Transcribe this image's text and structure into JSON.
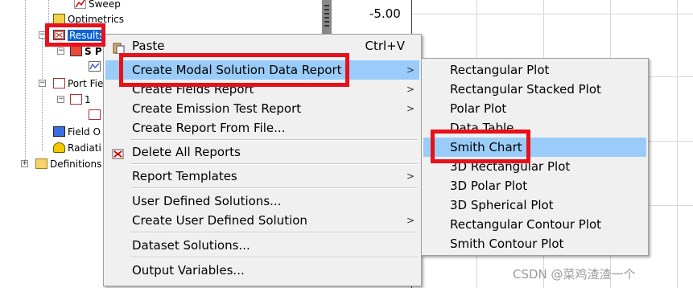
{
  "tree": {
    "sweep": "Sweep",
    "optimetrics": "Optimetrics",
    "results": "Results",
    "s_param": "S P",
    "port_field": "Port Fie",
    "port_1": "1",
    "field_overlays": "Field O",
    "radiation": "Radiati",
    "definitions": "Definitions"
  },
  "plot": {
    "y_tick": "-5.00"
  },
  "main_menu": {
    "items": [
      {
        "label": "Paste",
        "shortcut": "Ctrl+V"
      },
      {
        "label": "Create Modal Solution Data Report"
      },
      {
        "label": "Create Fields Report"
      },
      {
        "label": "Create Emission Test Report"
      },
      {
        "label": "Create Report From File..."
      },
      {
        "label": "Delete All Reports"
      },
      {
        "label": "Report Templates"
      },
      {
        "label": "User Defined Solutions..."
      },
      {
        "label": "Create User Defined Solution"
      },
      {
        "label": "Dataset Solutions..."
      },
      {
        "label": "Output Variables..."
      }
    ]
  },
  "sub_menu": {
    "items": [
      {
        "label": "Rectangular Plot"
      },
      {
        "label": "Rectangular Stacked Plot"
      },
      {
        "label": "Polar Plot"
      },
      {
        "label": "Data Table"
      },
      {
        "label": "Smith Chart"
      },
      {
        "label": "3D Rectangular Plot"
      },
      {
        "label": "3D Polar Plot"
      },
      {
        "label": "3D Spherical Plot"
      },
      {
        "label": "Rectangular Contour Plot"
      },
      {
        "label": "Smith Contour Plot"
      }
    ]
  },
  "watermark": "CSDN @菜鸡渣渣一个",
  "colors": {
    "highlight": "#99ccf9",
    "annotation_red": "#e8101a",
    "selection_blue": "#0a64d8"
  }
}
